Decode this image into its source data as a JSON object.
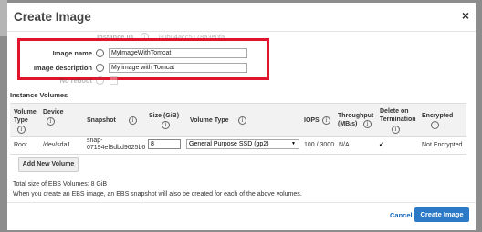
{
  "dialog": {
    "title": "Create Image",
    "close_glyph": "×"
  },
  "form": {
    "instance_id_label": "Instance ID",
    "instance_id_value": "i-0b04acc5178a3e0fa",
    "image_name_label": "Image name",
    "image_name_value": "MyImageWithTomcat",
    "image_description_label": "Image description",
    "image_description_value": "My image with Tomcat",
    "no_reboot_label": "No reboot",
    "no_reboot_checked": false
  },
  "volumes": {
    "section_title": "Instance Volumes",
    "headers": {
      "volume_type_line1": "Volume",
      "volume_type_line2": "Type",
      "device": "Device",
      "snapshot": "Snapshot",
      "size": "Size (GiB)",
      "vol_type": "Volume Type",
      "iops": "IOPS",
      "throughput_line1": "Throughput",
      "throughput_line2": "(MB/s)",
      "delete_line1": "Delete on",
      "delete_line2": "Termination",
      "encrypted": "Encrypted"
    },
    "rows": [
      {
        "volume_type": "Root",
        "device": "/dev/sda1",
        "snapshot_line1": "snap-",
        "snapshot_line2": "07194ef8dbd9625b6",
        "size": "8",
        "vol_type": "General Purpose SSD (gp2)",
        "iops": "100 / 3000",
        "throughput": "N/A",
        "delete_on_termination": "✔",
        "encrypted": "Not Encrypted"
      }
    ],
    "add_button": "Add New Volume",
    "total_size": "Total size of EBS Volumes: 8 GiB",
    "note": "When you create an EBS image, an EBS snapshot will also be created for each of the above volumes."
  },
  "footer": {
    "cancel": "Cancel",
    "create": "Create Image"
  },
  "icons": {
    "info": "i",
    "dropdown": "▼"
  },
  "colors": {
    "highlight_box": "#e0142c",
    "primary_button": "#2c79c8",
    "link": "#1166bb"
  }
}
